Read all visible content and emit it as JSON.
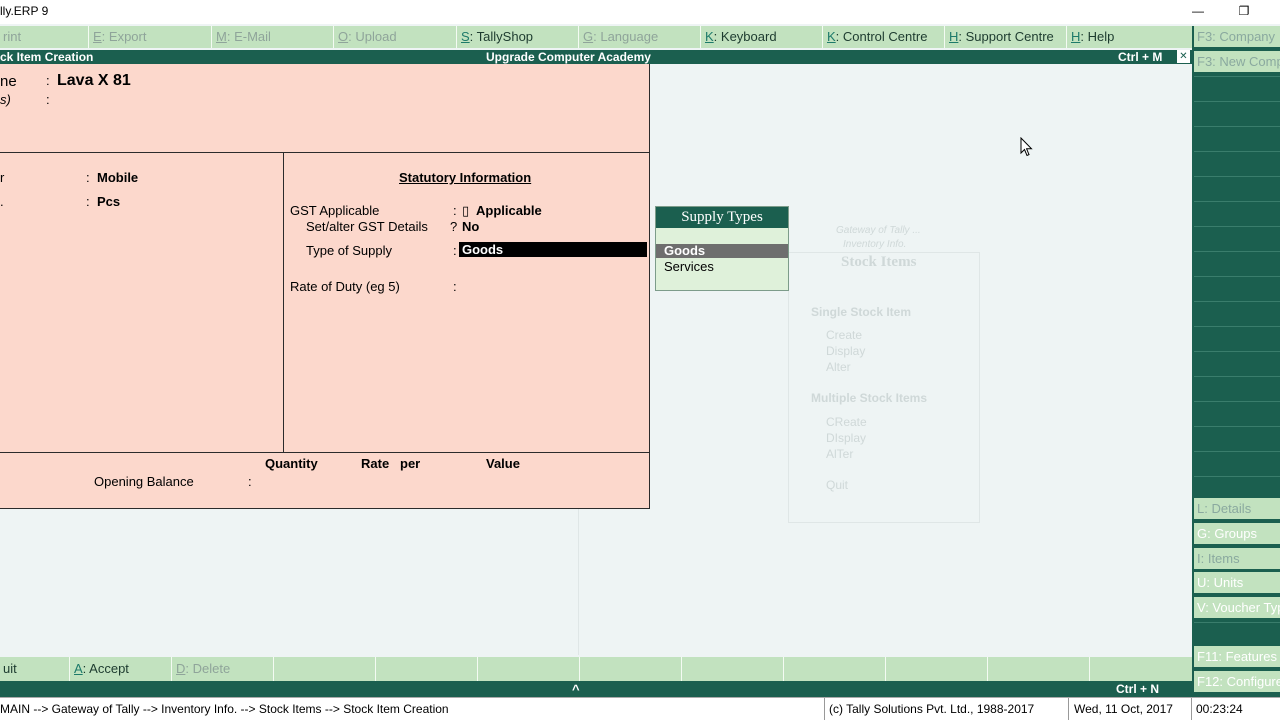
{
  "window": {
    "title": "lly.ERP 9",
    "min": "—",
    "restore": "❐"
  },
  "topmenu": [
    {
      "key": "",
      "label": "rint",
      "dis": true
    },
    {
      "key": "E",
      "label": ": Export",
      "dis": true
    },
    {
      "key": "M",
      "label": ": E-Mail",
      "dis": true
    },
    {
      "key": "O",
      "label": ": Upload",
      "dis": true
    },
    {
      "key": "S",
      "label": ": TallyShop",
      "dis": false
    },
    {
      "key": "G",
      "label": ": Language",
      "dis": true
    },
    {
      "key": "K",
      "label": ": Keyboard",
      "dis": false
    },
    {
      "key": "K",
      "label": ": Control Centre",
      "dis": false
    },
    {
      "key": "H",
      "label": ": Support Centre",
      "dis": false
    },
    {
      "key": "H",
      "label": ": Help",
      "dis": false
    }
  ],
  "header": {
    "left": "ck Item Creation",
    "center": "Upgrade Computer Academy",
    "right": "Ctrl + M",
    "close": "✕"
  },
  "form": {
    "name_label": "ne",
    "name_sep": ":",
    "name_value": "Lava X 81",
    "alias_label": "s)",
    "alias_sep": ":",
    "under_label": "r",
    "under_sep": ":",
    "under_value": "Mobile",
    "units_label": ".",
    "units_sep": ":",
    "units_value": "Pcs",
    "statutory_title": "Statutory Information",
    "gst_label": "GST Applicable",
    "gst_sep": ":",
    "gst_marker": "▯",
    "gst_value": "Applicable",
    "setalter_label": "Set/alter GST Details",
    "setalter_sep": "?",
    "setalter_value": "No",
    "supply_label": "Type of Supply",
    "supply_sep": ":",
    "supply_value": "Goods",
    "rate_label": "Rate of Duty (eg 5)",
    "rate_sep": ":",
    "col_quantity": "Quantity",
    "col_rate": "Rate",
    "col_per": "per",
    "col_value": "Value",
    "opening_label": "Opening Balance",
    "opening_sep": ":"
  },
  "popup": {
    "title": "Supply Types",
    "options": [
      "Goods",
      "Services"
    ],
    "selected": "Goods"
  },
  "gateway": {
    "line1": "Gateway of Tally ...",
    "line2": "Inventory Info.",
    "title": "Stock Items",
    "single": "Single Stock Item",
    "create": "Create",
    "display": "Display",
    "alter": "Alter",
    "multiple": "Multiple Stock Items",
    "mcreate": "CReate",
    "mdisplay": "DIsplay",
    "malter": "AlTer",
    "quit": "Quit"
  },
  "sidebar": {
    "f3company": "F3: Company",
    "f3new": "F3: New Comp",
    "details": "L: Details",
    "groups": "G: Groups",
    "items": "I: Items",
    "units": "U: Units",
    "voucher": "V: Voucher Typ",
    "f11": "F11: Features",
    "f12": "F12: Configure"
  },
  "bottombar": {
    "quit": "uit",
    "accept_key": "A",
    "accept": ": Accept",
    "delete_key": "D",
    "delete": ": Delete",
    "up": "^",
    "ctrl_n": "Ctrl + N"
  },
  "status": {
    "path": "MAIN --> Gateway of Tally --> Inventory Info. --> Stock Items --> Stock Item Creation",
    "copyright": "(c) Tally Solutions Pvt. Ltd., 1988-2017",
    "date": "Wed, 11 Oct, 2017",
    "time": "00:23:24"
  },
  "colors": {
    "teal": "#1b5f4f",
    "menu_green": "#c2e2bf",
    "form_pink": "#fcd8cc",
    "bg": "#eef4f4"
  }
}
